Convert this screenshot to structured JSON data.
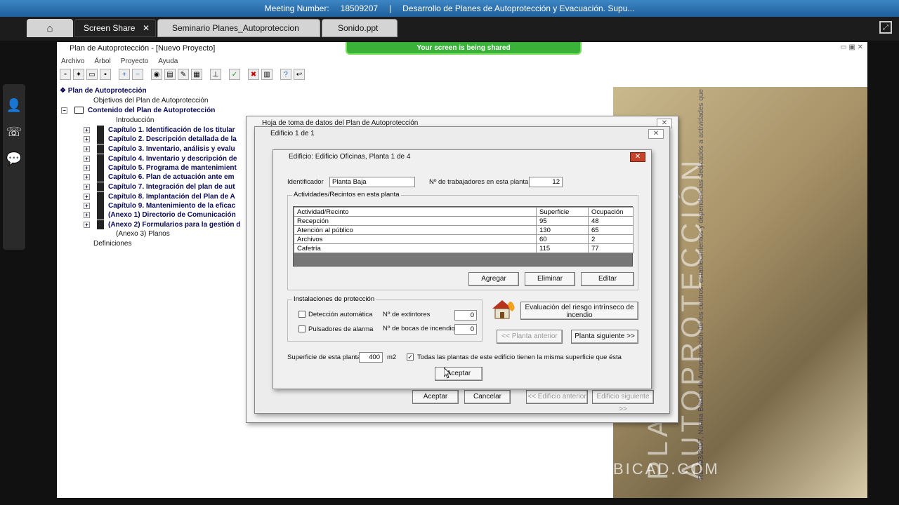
{
  "meeting": {
    "number_label": "Meeting Number:",
    "number": "18509207",
    "separator": "|",
    "title": "Desarrollo de Planes de Autoprotección y Evacuación. Supu..."
  },
  "tabs": [
    {
      "label": "Screen Share",
      "close": "✕"
    },
    {
      "label": "Seminario Planes_Autoproteccion"
    },
    {
      "label": "Sonido.ppt"
    }
  ],
  "app": {
    "title": "Plan de Autoprotección - [Nuevo Proyecto]",
    "share_banner": "Your screen is being shared",
    "menu": [
      "Archivo",
      "Árbol",
      "Proyecto",
      "Ayuda"
    ],
    "window_buttons": "▭  ▣  ✕"
  },
  "tree": {
    "root": "Plan de Autoprotección",
    "items": [
      "Objetivos del Plan de Autoprotección",
      "Contenido del Plan de Autoprotección",
      "Introducción",
      "Capítulo 1. Identificación de los titular",
      "Capítulo 2. Descripción detallada de la",
      "Capítulo 3. Inventario, análisis y evalu",
      "Capítulo 4. Inventario y descripción de",
      "Capítulo 5. Programa de mantenimient",
      "Capítulo 6. Plan de actuación ante em",
      "Capítulo 7. Integración del plan de aut",
      "Capítulo 8. Implantación del Plan de A",
      "Capítulo 9. Mantenimiento de la eficac",
      "(Anexo 1) Directorio de Comunicación",
      "(Anexo 2) Formularios para la gestión d",
      "(Anexo 3) Planos",
      "Definiciones"
    ]
  },
  "background": {
    "title_line1": "PLANES DE",
    "title_line2": "AUTOPROTECCIÓN",
    "subtitle": "RD 393/2007, Norma Básica de Autoprotección de los centros, establecimientos y dependencias dedicados a actividades que puedan dar origen a situaciones de emergencia",
    "url": "BICAD.COM"
  },
  "dlg_hoja": {
    "title": "Hoja de toma de datos del Plan de Autoprotección"
  },
  "dlg_edificio_outer": {
    "title": "Edificio 1 de 1",
    "accept": "Aceptar",
    "cancel": "Cancelar",
    "prev": "<< Edificio anterior",
    "next": "Edificio siguiente >>"
  },
  "dlg_planta": {
    "title": "Edificio: Edificio Oficinas, Planta 1 de 4",
    "identificador_label": "Identificador",
    "identificador_value": "Planta Baja",
    "trabajadores_label": "Nº de trabajadores en esta planta",
    "trabajadores_value": "12",
    "actividades_group": "Actividades/Recintos en esta planta",
    "table": {
      "headers": [
        "Actividad/Recinto",
        "Superficie",
        "Ocupación"
      ],
      "rows": [
        [
          "Recepción",
          "95",
          "48"
        ],
        [
          "Atención al público",
          "130",
          "65"
        ],
        [
          "Archivos",
          "60",
          "2"
        ],
        [
          "Cafetría",
          "115",
          "77"
        ]
      ]
    },
    "agregar": "Agregar",
    "eliminar": "Eliminar",
    "editar": "Editar",
    "instalaciones_group": "Instalaciones de protección",
    "deteccion": "Detección automática",
    "pulsadores": "Pulsadores de alarma",
    "extintores_label": "Nº de extintores",
    "extintores_value": "0",
    "bocas_label": "Nº de bocas de incendio",
    "bocas_value": "0",
    "evaluacion": "Evaluación del riesgo intrínseco de incendio",
    "planta_anterior": "<< Planta anterior",
    "planta_siguiente": "Planta siguiente >>",
    "superficie_label": "Superficie de esta planta",
    "superficie_value": "400",
    "superficie_unit": "m2",
    "todas_label": "Todas las plantas de este edificio tienen la misma superficie que ésta",
    "todas_checked": "✓",
    "aceptar": "Aceptar"
  }
}
